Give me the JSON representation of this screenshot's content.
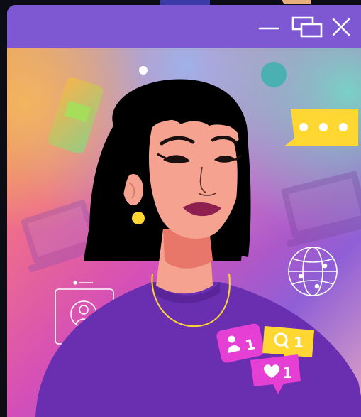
{
  "window": {
    "controls": {
      "minimize_icon": "minimize-icon",
      "restore_icon": "restore-icon",
      "close_icon": "close-icon"
    },
    "colors": {
      "titlebar": "#7e58d2",
      "accent_pink": "#e63fd3",
      "accent_yellow": "#ffd733",
      "shirt_purple": "#6a2fb0"
    }
  },
  "notifications": {
    "followers_count": "1",
    "comments_count": "1",
    "likes_count": "1",
    "chat_bubble_icon": "chat-dots-icon"
  },
  "illustration": {
    "profile_icon": "profile-card-icon",
    "globe_icon": "globe-icon",
    "phone_icon": "phone-icon",
    "laptop_icon": "laptop-icon"
  }
}
